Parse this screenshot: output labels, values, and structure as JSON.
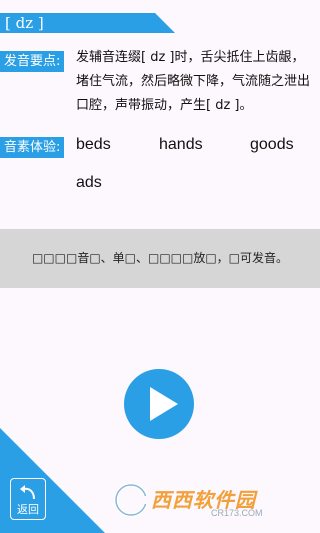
{
  "header": {
    "title": "[ dz ]"
  },
  "pronunciation": {
    "label": "发音要点:",
    "text": "发辅音连缀[ dz ]时，舌尖抵住上齿龈，堵住气流，然后略微下降，气流随之泄出口腔，声带振动，产生[ dz ]。"
  },
  "experience": {
    "label": "音素体验:",
    "words": [
      "beds",
      "hands",
      "goods",
      "ads"
    ]
  },
  "notice": {
    "text": "□□□□音□、单□、□□□□放□，□可发音。"
  },
  "player": {
    "icon": "play-icon"
  },
  "back": {
    "label": "返回",
    "icon": "back-arrow-icon"
  },
  "watermark": {
    "brand": "西西软件园",
    "site": "CR173.COM"
  },
  "colors": {
    "accent": "#2a9fe6",
    "notice_bg": "#d6d6d6",
    "background": "#fdf8fd"
  }
}
